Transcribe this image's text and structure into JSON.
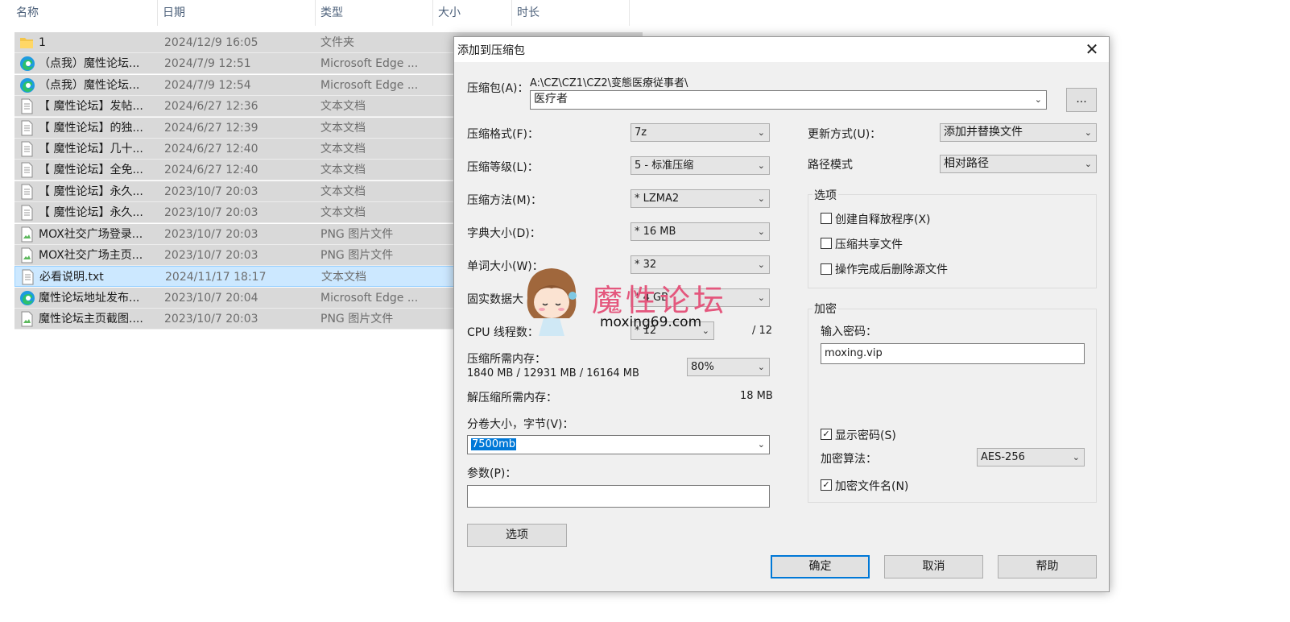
{
  "explorer": {
    "columns": [
      "名称",
      "日期",
      "类型",
      "大小",
      "时长"
    ],
    "files": [
      {
        "name": "1",
        "date": "2024/12/9 16:05",
        "type": "文件夹",
        "icon": "folder-icon"
      },
      {
        "name": "（点我）魔性论坛...",
        "date": "2024/7/9 12:51",
        "type": "Microsoft Edge ...",
        "icon": "edge-icon"
      },
      {
        "name": "（点我）魔性论坛...",
        "date": "2024/7/9 12:54",
        "type": "Microsoft Edge ...",
        "icon": "edge-icon"
      },
      {
        "name": "【 魔性论坛】发帖...",
        "date": "2024/6/27 12:36",
        "type": "文本文档",
        "icon": "text-file-icon"
      },
      {
        "name": "【 魔性论坛】的独...",
        "date": "2024/6/27 12:39",
        "type": "文本文档",
        "icon": "text-file-icon"
      },
      {
        "name": "【 魔性论坛】几十...",
        "date": "2024/6/27 12:40",
        "type": "文本文档",
        "icon": "text-file-icon"
      },
      {
        "name": "【 魔性论坛】全免...",
        "date": "2024/6/27 12:40",
        "type": "文本文档",
        "icon": "text-file-icon"
      },
      {
        "name": "【 魔性论坛】永久...",
        "date": "2023/10/7 20:03",
        "type": "文本文档",
        "icon": "text-file-icon"
      },
      {
        "name": "【 魔性论坛】永久...",
        "date": "2023/10/7 20:03",
        "type": "文本文档",
        "icon": "text-file-icon"
      },
      {
        "name": "MOX社交广场登录...",
        "date": "2023/10/7 20:03",
        "type": "PNG 图片文件",
        "icon": "image-file-icon"
      },
      {
        "name": "MOX社交广场主页...",
        "date": "2023/10/7 20:03",
        "type": "PNG 图片文件",
        "icon": "image-file-icon"
      },
      {
        "name": "必看说明.txt",
        "date": "2024/11/17 18:17",
        "type": "文本文档",
        "icon": "text-file-icon",
        "selected": true
      },
      {
        "name": "魔性论坛地址发布...",
        "date": "2023/10/7 20:04",
        "type": "Microsoft Edge ...",
        "icon": "edge-icon"
      },
      {
        "name": "魔性论坛主页截图....",
        "date": "2023/10/7 20:03",
        "type": "PNG 图片文件",
        "icon": "image-file-icon"
      }
    ]
  },
  "dialog": {
    "title": "添加到压缩包",
    "archive_label": "压缩包(A)：",
    "archive_path": "A:\\CZ\\CZ1\\CZ2\\变態医療従事者\\",
    "archive_name": "医疗者",
    "browse_label": "...",
    "format_label": "压缩格式(F)：",
    "format_value": "7z",
    "level_label": "压缩等级(L)：",
    "level_value": "5 - 标准压缩",
    "method_label": "压缩方法(M)：",
    "method_value": "* LZMA2",
    "dict_label": "字典大小(D)：",
    "dict_value": "* 16 MB",
    "word_label": "单词大小(W)：",
    "word_value": "* 32",
    "solid_label": "固实数据大",
    "solid_value": "* 4 GB",
    "threads_label": "CPU 线程数：",
    "threads_value": "* 12",
    "threads_max": "/ 12",
    "mem_label": "压缩所需内存：",
    "mem_value": "1840 MB / 12931 MB / 16164 MB",
    "mem_percent": "80%",
    "decomp_label": "解压缩所需内存：",
    "decomp_value": "18 MB",
    "split_label": "分卷大小，字节(V)：",
    "split_value": "7500mb",
    "params_label": "参数(P)：",
    "params_value": "",
    "options_button": "选项",
    "update_label": "更新方式(U)：",
    "update_value": "添加并替换文件",
    "path_label": "路径模式",
    "path_value": "相对路径",
    "options_group": "选项",
    "opt_sfx": "创建自释放程序(X)",
    "opt_shared": "压缩共享文件",
    "opt_delete": "操作完成后删除源文件",
    "encrypt_group": "加密",
    "password_label": "输入密码：",
    "password_value": "moxing.vip",
    "show_password": "显示密码(S)",
    "enc_method_label": "加密算法：",
    "enc_method_value": "AES-256",
    "encrypt_names": "加密文件名(N)",
    "ok": "确定",
    "cancel": "取消",
    "help": "帮助"
  },
  "watermark": {
    "text": "魔性论坛",
    "url": "moxing69.com"
  }
}
